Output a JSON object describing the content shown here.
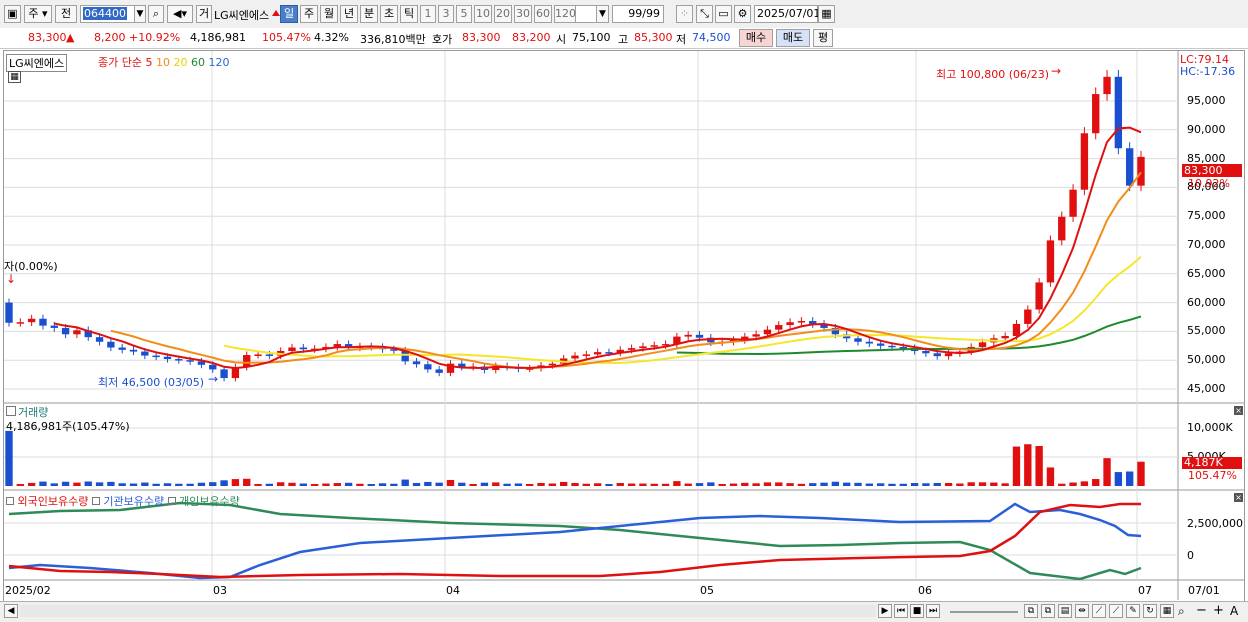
{
  "toolbar": {
    "market": "주",
    "prev": "전",
    "code": "064400",
    "trade": "거",
    "stock_name": "LG씨엔에스",
    "periods": [
      "일",
      "주",
      "월",
      "년",
      "분",
      "초",
      "틱"
    ],
    "active_period": "일",
    "intervals": [
      "1",
      "3",
      "5",
      "10",
      "20",
      "30",
      "60",
      "120"
    ],
    "count": "99/99",
    "date": "2025/07/01"
  },
  "quote": {
    "price": "83,300",
    "change_arrow": "▲",
    "change": "8,200",
    "change_pct": "+10.92%",
    "volume": "4,186,981",
    "volume_ratio": "105.47%",
    "turnover": "4.32%",
    "amount": "336,810백만",
    "ask_label": "호가",
    "ask": "83,300",
    "bid": "83,200",
    "open_label": "시",
    "open": "75,100",
    "high_label": "고",
    "high": "85,300",
    "low_label": "저",
    "low": "74,500",
    "buy_btn": "매수",
    "sell_btn": "매도",
    "eval_btn": "평"
  },
  "price_panel": {
    "name": "LG씨엔에스",
    "ma_label": "종가 단순",
    "ma_periods": [
      "5",
      "10",
      "20",
      "60",
      "120"
    ],
    "lc": "LC:79.14",
    "hc": "HC:-17.36",
    "high_note": "최고 100,800 (06/23)",
    "low_note": "최저 46,500 (03/05)",
    "start_note": "자(0.00%)",
    "current_price": "83,300",
    "current_pct": "10.92%",
    "y_ticks": [
      "95,000",
      "90,000",
      "85,000",
      "80,000",
      "75,000",
      "70,000",
      "65,000",
      "60,000",
      "55,000",
      "50,000",
      "45,000"
    ]
  },
  "volume_panel": {
    "title": "거래량",
    "info": "4,186,981주(105.47%)",
    "y_ticks": [
      "10,000K",
      "5,000K"
    ],
    "current": "4,187K",
    "current_pct": "105.47%"
  },
  "holding_panel": {
    "legend": [
      "외국인보유수량",
      "기관보유수량",
      "개인보유수량"
    ],
    "y_ticks": [
      "2,500,000",
      "0"
    ]
  },
  "x_axis": {
    "labels": [
      "2025/02",
      "03",
      "04",
      "05",
      "06",
      "07",
      "07/01"
    ]
  },
  "colors": {
    "up": "#e01010",
    "down": "#1a4fd0",
    "ma5": "#e01010",
    "ma10": "#f28c1a",
    "ma20": "#f5e62a",
    "ma60": "#1e8a2e",
    "ma120": "#2a6ad0",
    "foreign": "#e01010",
    "institution": "#2a5fd8",
    "individual": "#2e8b57"
  },
  "chart_data": {
    "type": "candlestick",
    "dates": [
      "02/03",
      "02/04",
      "02/05",
      "02/06",
      "02/07",
      "02/10",
      "02/11",
      "02/12",
      "02/13",
      "02/14",
      "02/17",
      "02/18",
      "02/19",
      "02/20",
      "02/21",
      "02/24",
      "02/25",
      "02/26",
      "02/27",
      "02/28",
      "03/04",
      "03/05",
      "03/06",
      "03/07",
      "03/10",
      "03/11",
      "03/12",
      "03/13",
      "03/14",
      "03/17",
      "03/18",
      "03/19",
      "03/20",
      "03/21",
      "03/24",
      "03/25",
      "03/26",
      "03/27",
      "03/28",
      "03/31",
      "04/01",
      "04/02",
      "04/03",
      "04/04",
      "04/07",
      "04/08",
      "04/09",
      "04/10",
      "04/11",
      "04/14",
      "04/15",
      "04/16",
      "04/17",
      "04/18",
      "04/21",
      "04/22",
      "04/23",
      "04/24",
      "04/25",
      "04/28",
      "04/29",
      "04/30",
      "05/02",
      "05/07",
      "05/08",
      "05/09",
      "05/12",
      "05/13",
      "05/14",
      "05/15",
      "05/16",
      "05/19",
      "05/20",
      "05/21",
      "05/22",
      "05/23",
      "05/26",
      "05/27",
      "05/28",
      "05/29",
      "05/30",
      "06/02",
      "06/04",
      "06/05",
      "06/09",
      "06/10",
      "06/11",
      "06/12",
      "06/13",
      "06/16",
      "06/17",
      "06/18",
      "06/19",
      "06/20",
      "06/23",
      "06/24",
      "06/25",
      "06/26",
      "06/27",
      "06/30",
      "07/01"
    ],
    "close": [
      56500,
      56600,
      57200,
      56000,
      55600,
      54500,
      55200,
      54000,
      53200,
      52200,
      51800,
      51500,
      50800,
      50600,
      50200,
      50000,
      49800,
      49200,
      48400,
      46900,
      48800,
      50900,
      51000,
      50800,
      51600,
      52200,
      51900,
      52000,
      52300,
      52800,
      52200,
      52400,
      52300,
      51900,
      51700,
      49800,
      49300,
      48400,
      47800,
      49400,
      48800,
      48900,
      48300,
      49000,
      48800,
      48500,
      48600,
      49100,
      49400,
      50300,
      50800,
      51000,
      51400,
      51300,
      51800,
      52100,
      52400,
      52600,
      52800,
      54100,
      54400,
      53900,
      53100,
      53200,
      53500,
      54100,
      54500,
      55300,
      56100,
      56600,
      56800,
      56300,
      55600,
      54500,
      53800,
      53200,
      52900,
      52500,
      52300,
      52100,
      51600,
      51200,
      50700,
      51200,
      51500,
      52300,
      53100,
      53800,
      54200,
      56300,
      58800,
      63500,
      70800,
      74900,
      79600,
      89400,
      96200,
      99200,
      86800,
      80300,
      85300
    ]
  }
}
